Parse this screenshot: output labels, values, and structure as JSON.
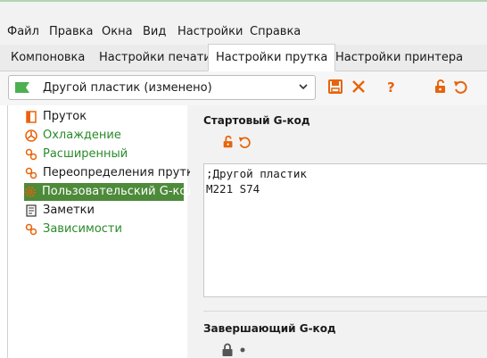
{
  "menubar": {
    "items": [
      "Файл",
      "Правка",
      "Окна",
      "Вид",
      "Настройки",
      "Справка"
    ]
  },
  "tabs": [
    {
      "label": "Компоновка",
      "active": false
    },
    {
      "label": "Настройки печати",
      "active": false
    },
    {
      "label": "Настройки прутка",
      "active": true
    },
    {
      "label": "Настройки принтера",
      "active": false
    }
  ],
  "preset": {
    "value": "Другой пластик (изменено)",
    "flag_color": "#4caf50"
  },
  "toolbar": {
    "icons": [
      "save-icon",
      "delete-icon",
      "help-icon",
      "lock-open-icon",
      "undo-icon"
    ],
    "accent": "#e8630a"
  },
  "tree": {
    "items": [
      {
        "label": "Пруток",
        "icon": "filament-icon",
        "green": false
      },
      {
        "label": "Охлаждение",
        "icon": "fan-icon",
        "green": true
      },
      {
        "label": "Расширенный",
        "icon": "gears-icon",
        "green": true
      },
      {
        "label": "Переопределения прутка",
        "icon": "gears-icon",
        "green": false
      },
      {
        "label": "Пользовательский G-код",
        "icon": "gear-icon",
        "green": false,
        "selected": true
      },
      {
        "label": "Заметки",
        "icon": "notes-icon",
        "green": false
      },
      {
        "label": "Зависимости",
        "icon": "gears-icon",
        "green": true
      }
    ]
  },
  "start_gcode": {
    "title": "Стартовый G-код",
    "lines": [
      ";Другой пластик",
      "M221 S74"
    ]
  },
  "end_gcode": {
    "title": "Завершающий G-код"
  }
}
